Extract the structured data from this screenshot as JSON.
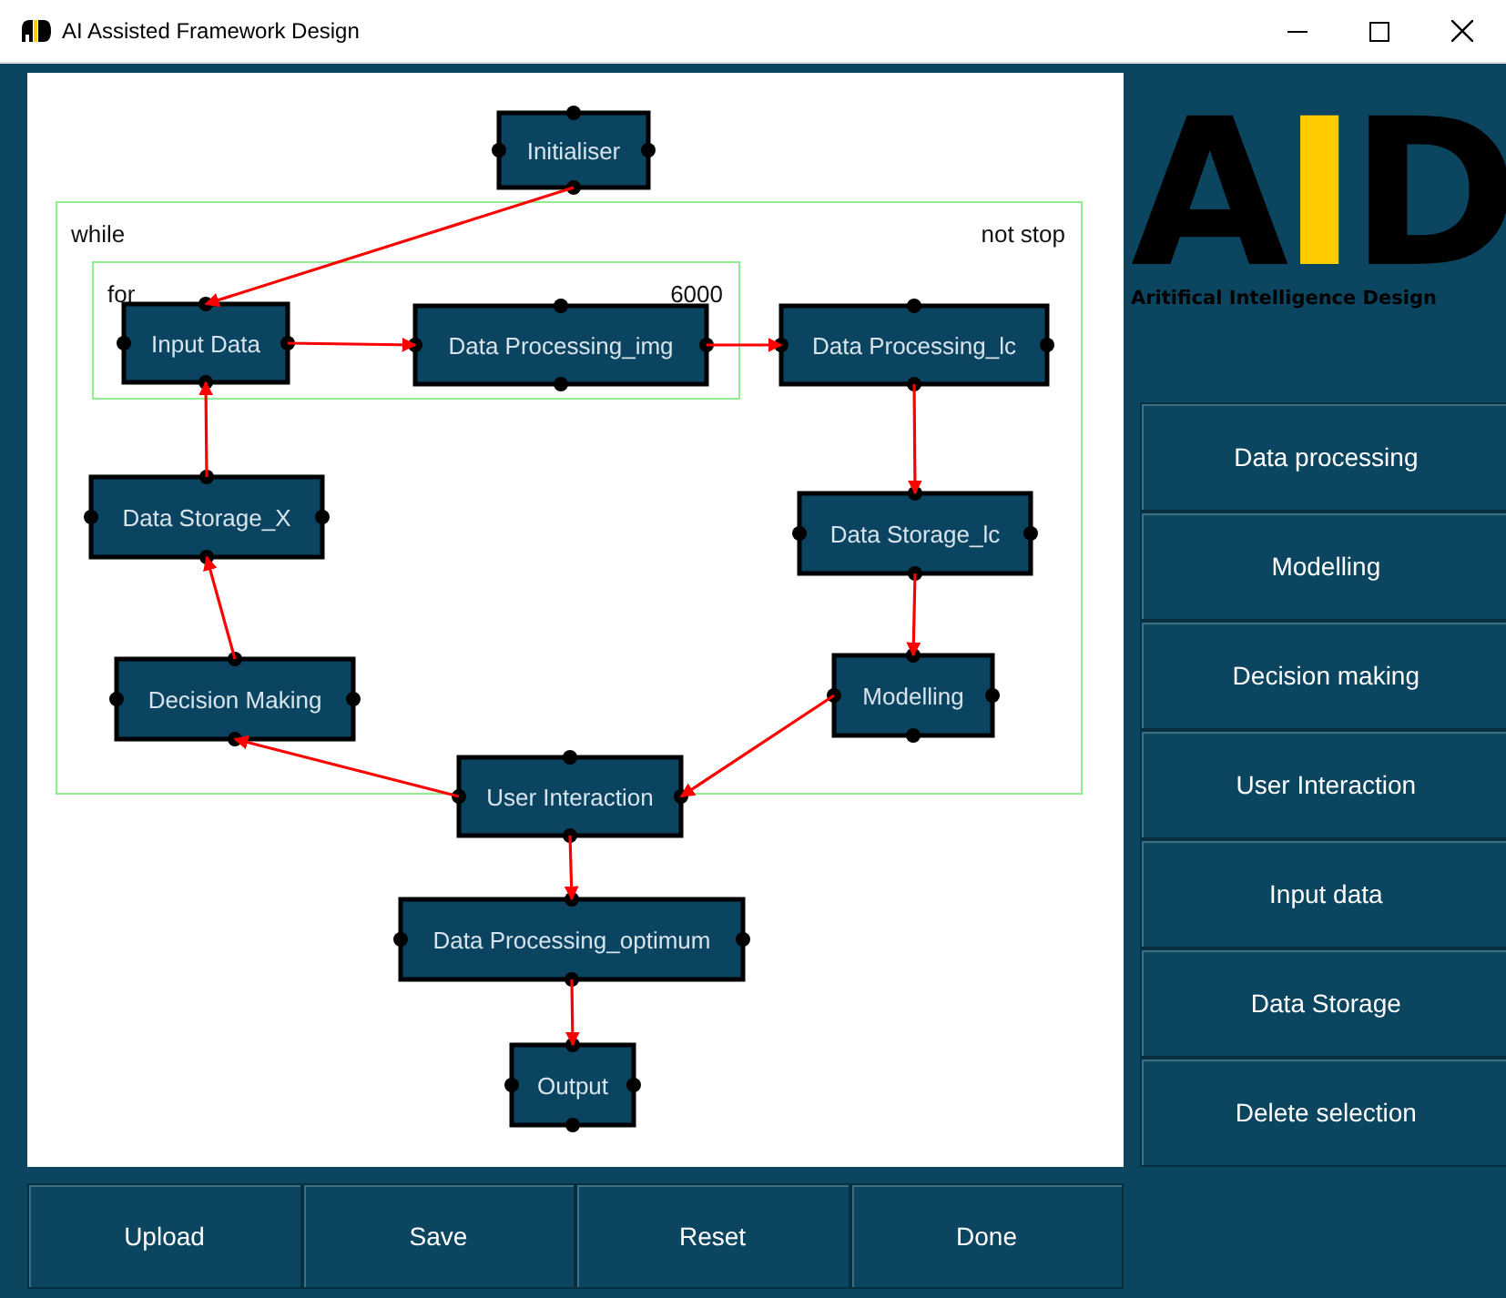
{
  "window": {
    "title": "AI Assisted Framework Design"
  },
  "diagram": {
    "loops": [
      {
        "label": "while",
        "condition": "not stop"
      },
      {
        "label": "for",
        "condition": "6000"
      }
    ],
    "nodes": [
      {
        "label": "Initialiser"
      },
      {
        "label": "Input Data"
      },
      {
        "label": "Data Processing_img"
      },
      {
        "label": "Data Processing_lc"
      },
      {
        "label": "Data Storage_X"
      },
      {
        "label": "Data Storage_lc"
      },
      {
        "label": "Decision Making"
      },
      {
        "label": "Modelling"
      },
      {
        "label": "User Interaction"
      },
      {
        "label": "Data Processing_optimum"
      },
      {
        "label": "Output"
      }
    ]
  },
  "logo": {
    "mark": "AID",
    "tagline": "Aritifical Intelligence Design"
  },
  "side_buttons": [
    "Data processing",
    "Modelling",
    "Decision making",
    "User Interaction",
    "Input data",
    "Data Storage",
    "Delete selection"
  ],
  "bottom_buttons": [
    "Upload",
    "Save",
    "Reset",
    "Done"
  ]
}
